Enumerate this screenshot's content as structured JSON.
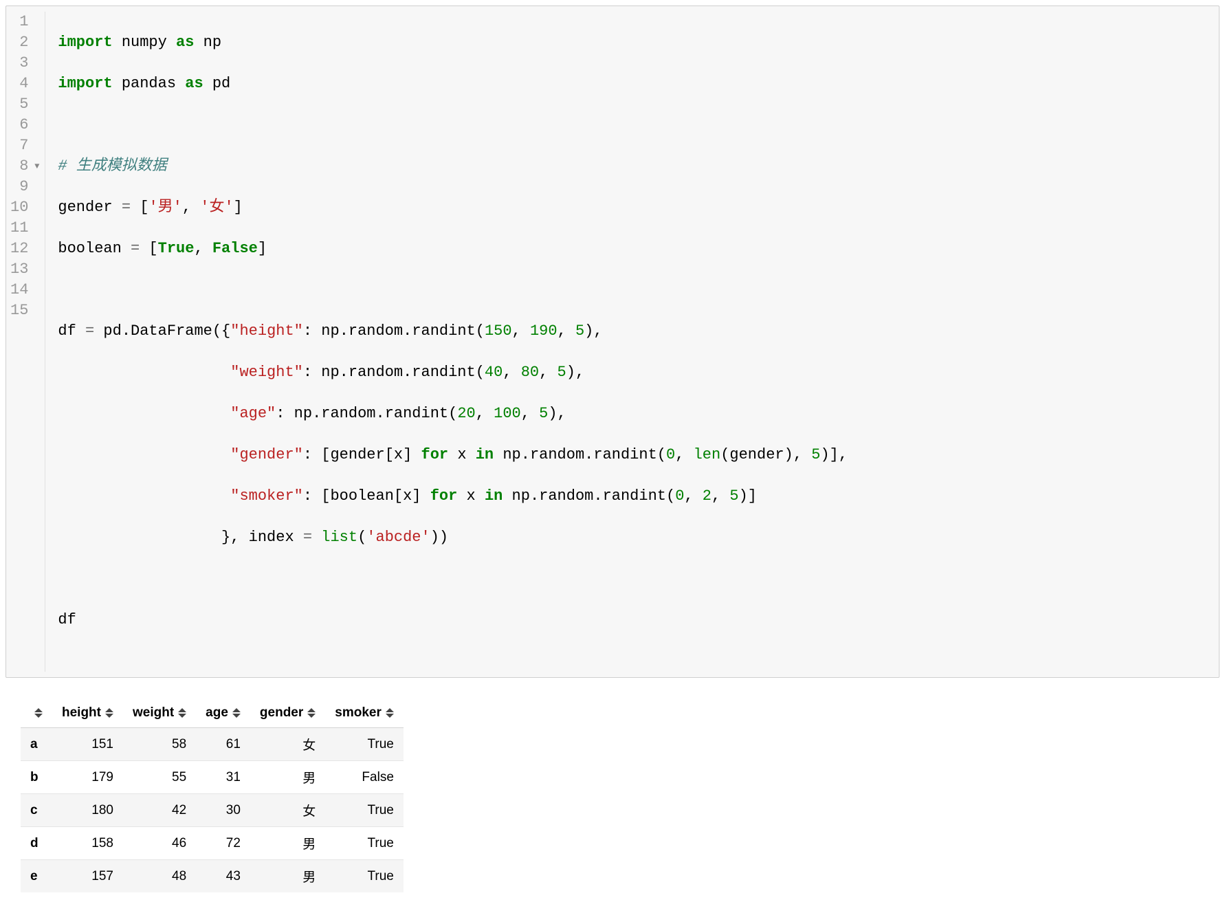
{
  "code": {
    "line_numbers": [
      "1",
      "2",
      "3",
      "4",
      "5",
      "6",
      "7",
      "8",
      "9",
      "10",
      "11",
      "12",
      "13",
      "14",
      "15"
    ],
    "fold_line": 8,
    "lines": {
      "l1_import1": "import",
      "l1_numpy": " numpy ",
      "l1_as": "as",
      "l1_np": " np",
      "l2_import": "import",
      "l2_pandas": " pandas ",
      "l2_as": "as",
      "l2_pd": " pd",
      "l4_comment": "# 生成模拟数据",
      "l5_gender": "gender ",
      "l5_eq": "=",
      "l5_sp": " [",
      "l5_s1": "'男'",
      "l5_comma": ", ",
      "l5_s2": "'女'",
      "l5_close": "]",
      "l6_bool": "boolean ",
      "l6_eq": "=",
      "l6_sp": " [",
      "l6_true": "True",
      "l6_comma": ", ",
      "l6_false": "False",
      "l6_close": "]",
      "l8_df": "df ",
      "l8_eq": "=",
      "l8_pddf": " pd.DataFrame({",
      "l8_key": "\"height\"",
      "l8_colon": ": np.random.randint(",
      "l8_n1": "150",
      "l8_c1": ", ",
      "l8_n2": "190",
      "l8_c2": ", ",
      "l8_n3": "5",
      "l8_close": "),",
      "l9_pad": "                   ",
      "l9_key": "\"weight\"",
      "l9_colon": ": np.random.randint(",
      "l9_n1": "40",
      "l9_c1": ", ",
      "l9_n2": "80",
      "l9_c2": ", ",
      "l9_n3": "5",
      "l9_close": "),",
      "l10_pad": "                   ",
      "l10_key": "\"age\"",
      "l10_colon": ": np.random.randint(",
      "l10_n1": "20",
      "l10_c1": ", ",
      "l10_n2": "100",
      "l10_c2": ", ",
      "l10_n3": "5",
      "l10_close": "),",
      "l11_pad": "                   ",
      "l11_key": "\"gender\"",
      "l11_colon": ": [gender[x] ",
      "l11_for": "for",
      "l11_x": " x ",
      "l11_in": "in",
      "l11_rest": " np.random.randint(",
      "l11_n1": "0",
      "l11_c1": ", ",
      "l11_len": "len",
      "l11_leng": "(gender), ",
      "l11_n3": "5",
      "l11_close": ")],",
      "l12_pad": "                   ",
      "l12_key": "\"smoker\"",
      "l12_colon": ": [boolean[x] ",
      "l12_for": "for",
      "l12_x": " x ",
      "l12_in": "in",
      "l12_rest": " np.random.randint(",
      "l12_n1": "0",
      "l12_c1": ", ",
      "l12_n2": "2",
      "l12_c2": ", ",
      "l12_n3": "5",
      "l12_close": ")]",
      "l13_pad": "                  }, index ",
      "l13_eq": "=",
      "l13_sp": " ",
      "l13_list": "list",
      "l13_open": "(",
      "l13_str": "'abcde'",
      "l13_close": "))",
      "l15_df": "df"
    }
  },
  "table": {
    "columns": [
      "height",
      "weight",
      "age",
      "gender",
      "smoker"
    ],
    "rows": [
      {
        "idx": "a",
        "height": "151",
        "weight": "58",
        "age": "61",
        "gender": "女",
        "smoker": "True"
      },
      {
        "idx": "b",
        "height": "179",
        "weight": "55",
        "age": "31",
        "gender": "男",
        "smoker": "False"
      },
      {
        "idx": "c",
        "height": "180",
        "weight": "42",
        "age": "30",
        "gender": "女",
        "smoker": "True"
      },
      {
        "idx": "d",
        "height": "158",
        "weight": "46",
        "age": "72",
        "gender": "男",
        "smoker": "True"
      },
      {
        "idx": "e",
        "height": "157",
        "weight": "48",
        "age": "43",
        "gender": "男",
        "smoker": "True"
      }
    ]
  }
}
